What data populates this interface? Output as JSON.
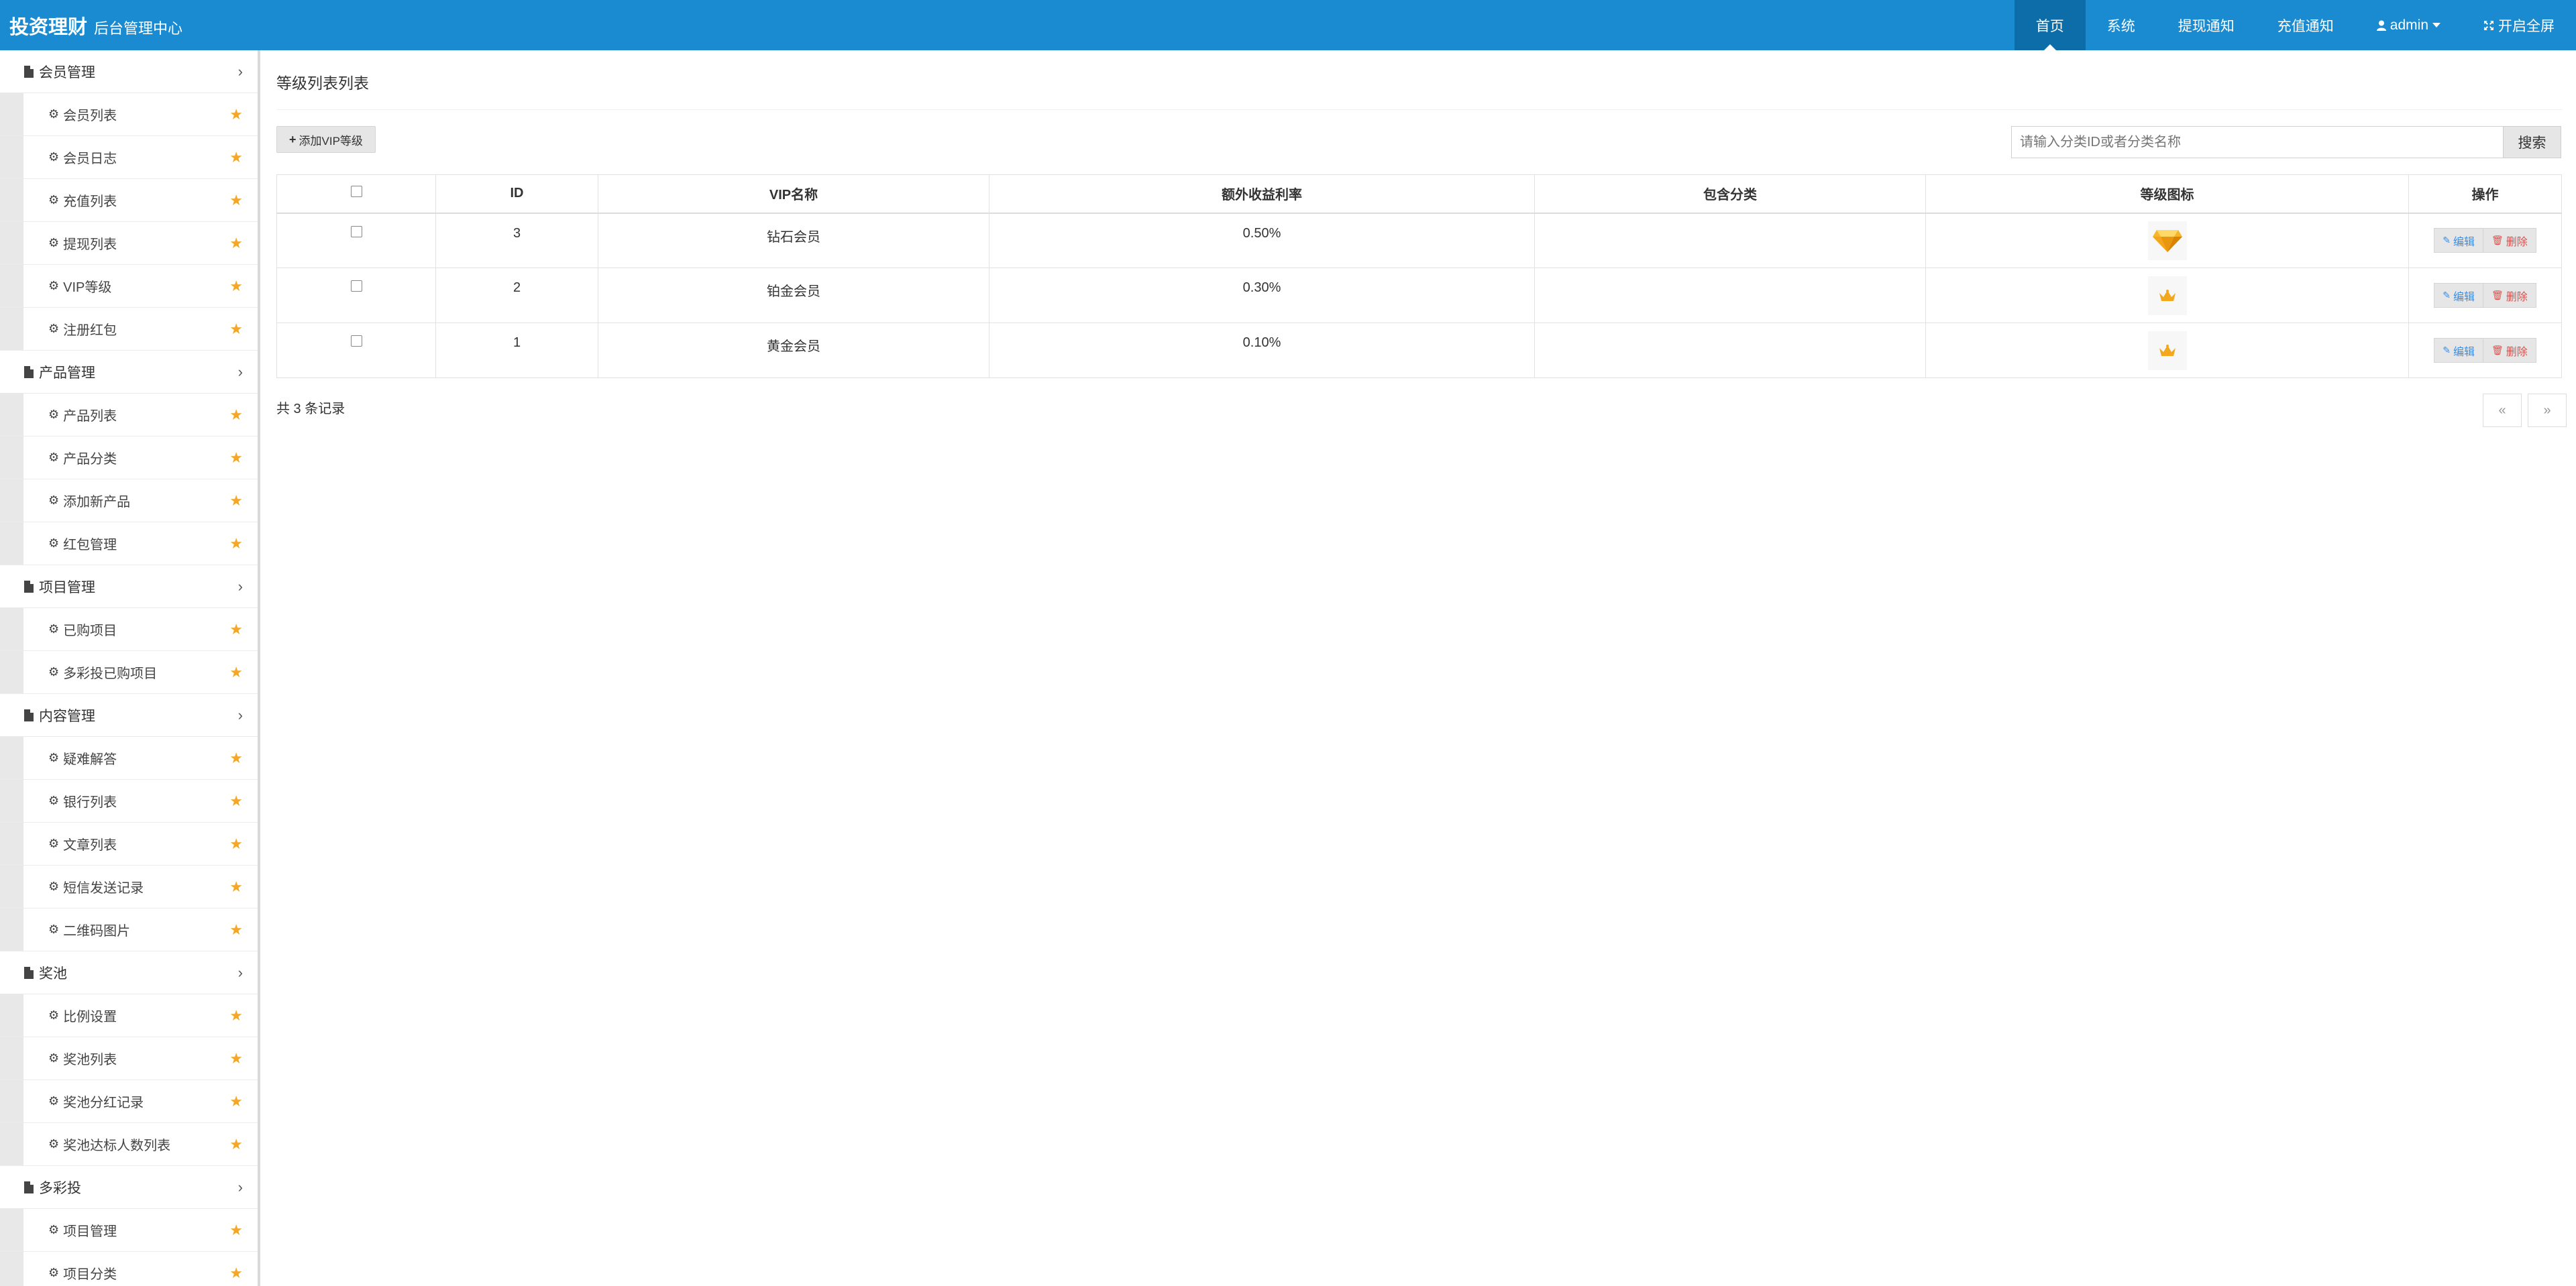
{
  "header": {
    "brand_name": "投资理财",
    "brand_sub": "后台管理中心",
    "nav": [
      {
        "label": "首页"
      },
      {
        "label": "系统"
      },
      {
        "label": "提现通知"
      },
      {
        "label": "充值通知"
      },
      {
        "label": "admin"
      },
      {
        "label": "开启全屏"
      }
    ]
  },
  "sidebar": {
    "groups": [
      {
        "label": "会员管理",
        "items": [
          "会员列表",
          "会员日志",
          "充值列表",
          "提现列表",
          "VIP等级",
          "注册红包"
        ]
      },
      {
        "label": "产品管理",
        "items": [
          "产品列表",
          "产品分类",
          "添加新产品",
          "红包管理"
        ]
      },
      {
        "label": "项目管理",
        "items": [
          "已购项目",
          "多彩投已购项目"
        ]
      },
      {
        "label": "内容管理",
        "items": [
          "疑难解答",
          "银行列表",
          "文章列表",
          "短信发送记录",
          "二维码图片"
        ]
      },
      {
        "label": "奖池",
        "items": [
          "比例设置",
          "奖池列表",
          "奖池分红记录",
          "奖池达标人数列表"
        ]
      },
      {
        "label": "多彩投",
        "items": [
          "项目管理",
          "项目分类"
        ]
      }
    ]
  },
  "main": {
    "title": "等级列表列表",
    "add_button": "添加VIP等级",
    "search_placeholder": "请输入分类ID或者分类名称",
    "search_button": "搜索",
    "table": {
      "columns": [
        "",
        "ID",
        "VIP名称",
        "额外收益利率",
        "包含分类",
        "等级图标",
        "操作"
      ],
      "rows": [
        {
          "id": "3",
          "name": "钻石会员",
          "rate": "0.50%",
          "category": "",
          "icon": "diamond-icon"
        },
        {
          "id": "2",
          "name": "铂金会员",
          "rate": "0.30%",
          "category": "",
          "icon": "crown-icon"
        },
        {
          "id": "1",
          "name": "黄金会员",
          "rate": "0.10%",
          "category": "",
          "icon": "crown-icon"
        }
      ],
      "edit_label": "编辑",
      "delete_label": "删除"
    },
    "record_count": "共 3 条记录",
    "pager": {
      "prev": "«",
      "next": "»"
    }
  },
  "colors": {
    "topbar": "#1a8bd0",
    "topbar_active": "#0d6da8",
    "star": "#f5a623",
    "edit": "#3a8ee6",
    "delete": "#d9534f"
  }
}
